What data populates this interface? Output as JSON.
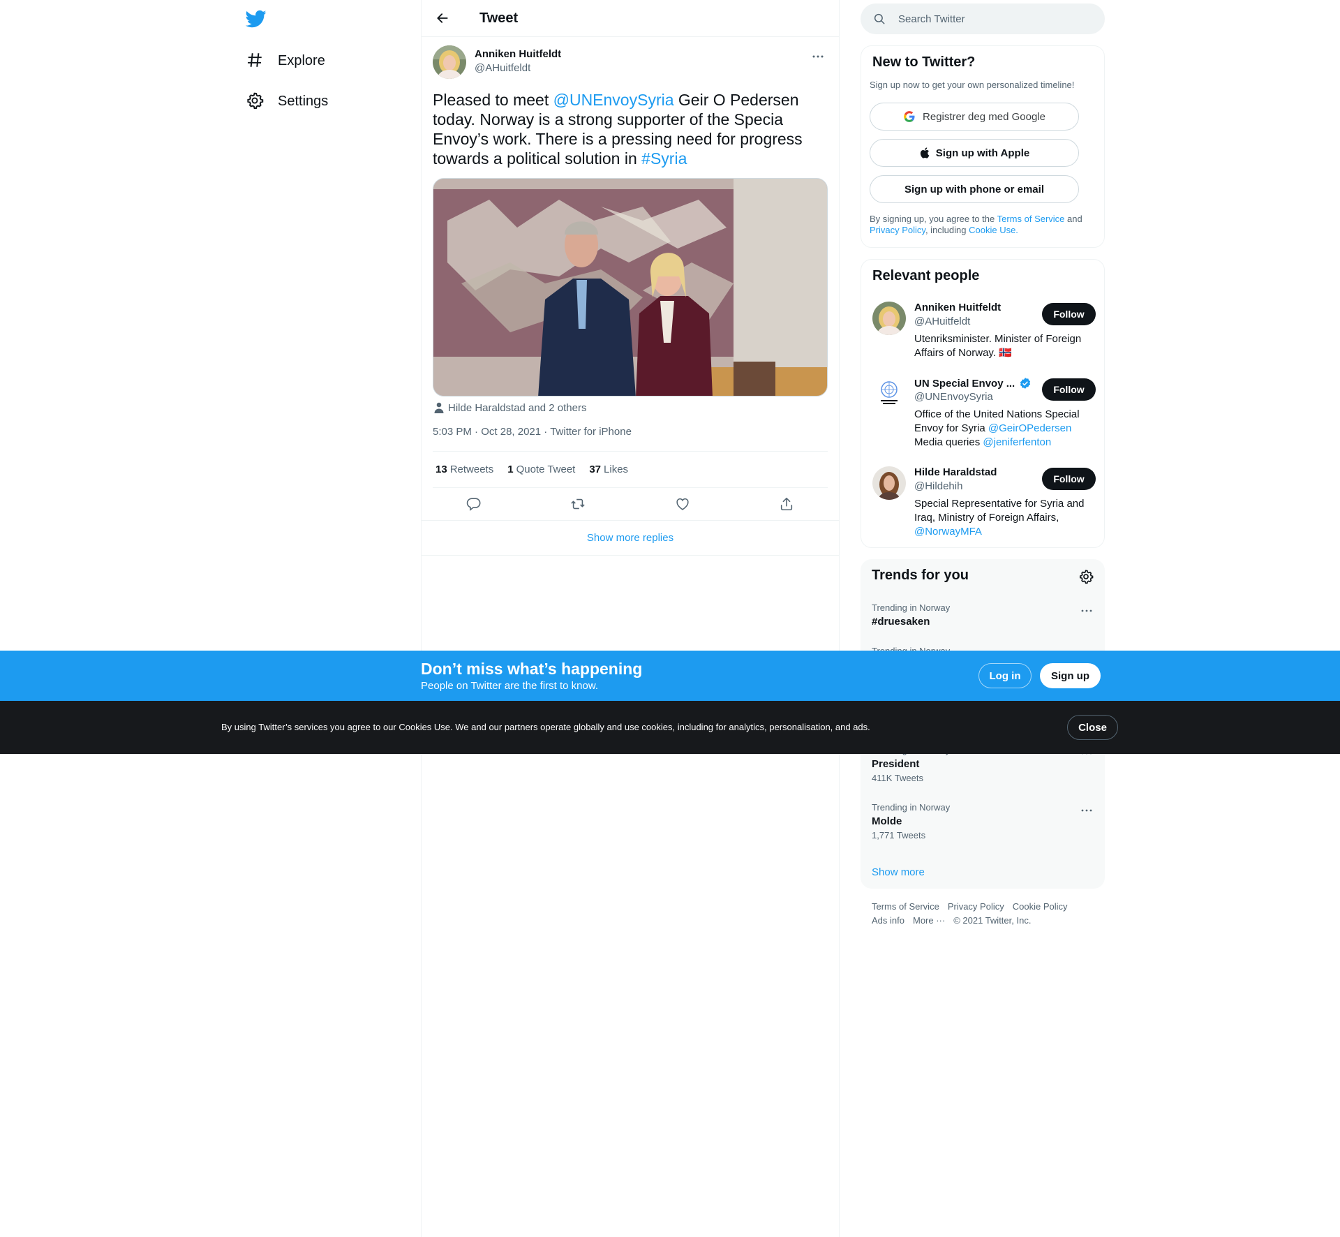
{
  "nav": {
    "logo": "twitter-bird-icon",
    "items": [
      {
        "label": "Explore",
        "icon": "hashtag-icon"
      },
      {
        "label": "Settings",
        "icon": "gear-icon"
      }
    ]
  },
  "header": {
    "title": "Tweet"
  },
  "tweet": {
    "author_name": "Anniken Huitfeldt",
    "author_handle": "@AHuitfeldt",
    "text_1": "Pleased to meet ",
    "mention": "@UNEnvoySyria",
    "text_2": " Geir O Pedersen today. Norway is a strong supporter of the Specia Envoy’s work. There is a pressing need for progress towards a political solution in ",
    "hashtag": "#Syria",
    "tagged": "Hilde Haraldstad and 2 others",
    "time": "5:03 PM",
    "date": "Oct 28, 2021",
    "source": "Twitter for iPhone",
    "separator": " · ",
    "retweets_count": "13",
    "retweets_label": "Retweets",
    "quotes_count": "1",
    "quotes_label": "Quote Tweet",
    "likes_count": "37",
    "likes_label": "Likes",
    "show_more_replies": "Show more replies"
  },
  "search": {
    "placeholder": "Search Twitter"
  },
  "signup": {
    "title": "New to Twitter?",
    "subtitle": "Sign up now to get your own personalized timeline!",
    "google_label": "Registrer deg med Google",
    "apple_label": "Sign up with Apple",
    "phone_label": "Sign up with phone or email",
    "legal_1": "By signing up, you agree to the ",
    "terms": "Terms of Service",
    "legal_2": " and ",
    "privacy": "Privacy Policy",
    "legal_3": ", including ",
    "cookie": "Cookie Use."
  },
  "people": {
    "title": "Relevant people",
    "follow_label": "Follow",
    "list": [
      {
        "name": "Anniken Huitfeldt",
        "handle": "@AHuitfeldt",
        "bio": "Utenriksminister. Minister of Foreign Affairs of Norway. 🇳🇴"
      },
      {
        "name": "UN Special Envoy ...",
        "handle": "@UNEnvoySyria",
        "bio_1": "Office of the United Nations Special Envoy for Syria ",
        "bio_mention": "@GeirOPedersen",
        "bio_2": " Media queries ",
        "bio_mention2": "@jeniferfenton"
      },
      {
        "name": "Hilde Haraldstad",
        "handle": "@Hildehih",
        "bio_1": "Special Representative for Syria and Iraq, Ministry of Foreign Affairs, ",
        "bio_mention": "@NorwayMFA"
      }
    ]
  },
  "trends": {
    "title": "Trends for you",
    "items": [
      {
        "meta": "Trending in Norway",
        "name": "#druesaken",
        "count": ""
      },
      {
        "meta": "Trending in Norway",
        "name": "",
        "count": ""
      },
      {
        "meta": "Trending in Norway",
        "name": "President",
        "count": "411K Tweets"
      },
      {
        "meta": "Trending in Norway",
        "name": "Molde",
        "count": "1,771 Tweets"
      }
    ],
    "show_more": "Show more"
  },
  "footer": {
    "links": [
      "Terms of Service",
      "Privacy Policy",
      "Cookie Policy",
      "Ads info",
      "More ···"
    ],
    "copyright": "© 2021 Twitter, Inc."
  },
  "banner": {
    "title": "Don’t miss what’s happening",
    "subtitle": "People on Twitter are the first to know.",
    "login_label": "Log in",
    "signup_label": "Sign up"
  },
  "cookies": {
    "text": "By using Twitter’s services you agree to our Cookies Use. We and our partners operate globally and use cookies, including for analytics, personalisation, and ads.",
    "close_label": "Close"
  },
  "colors": {
    "accent": "#1d9bf0",
    "text": "#0f1419",
    "muted": "#536471",
    "banner": "#1d9bf0",
    "cookie_bar": "#17191c"
  }
}
